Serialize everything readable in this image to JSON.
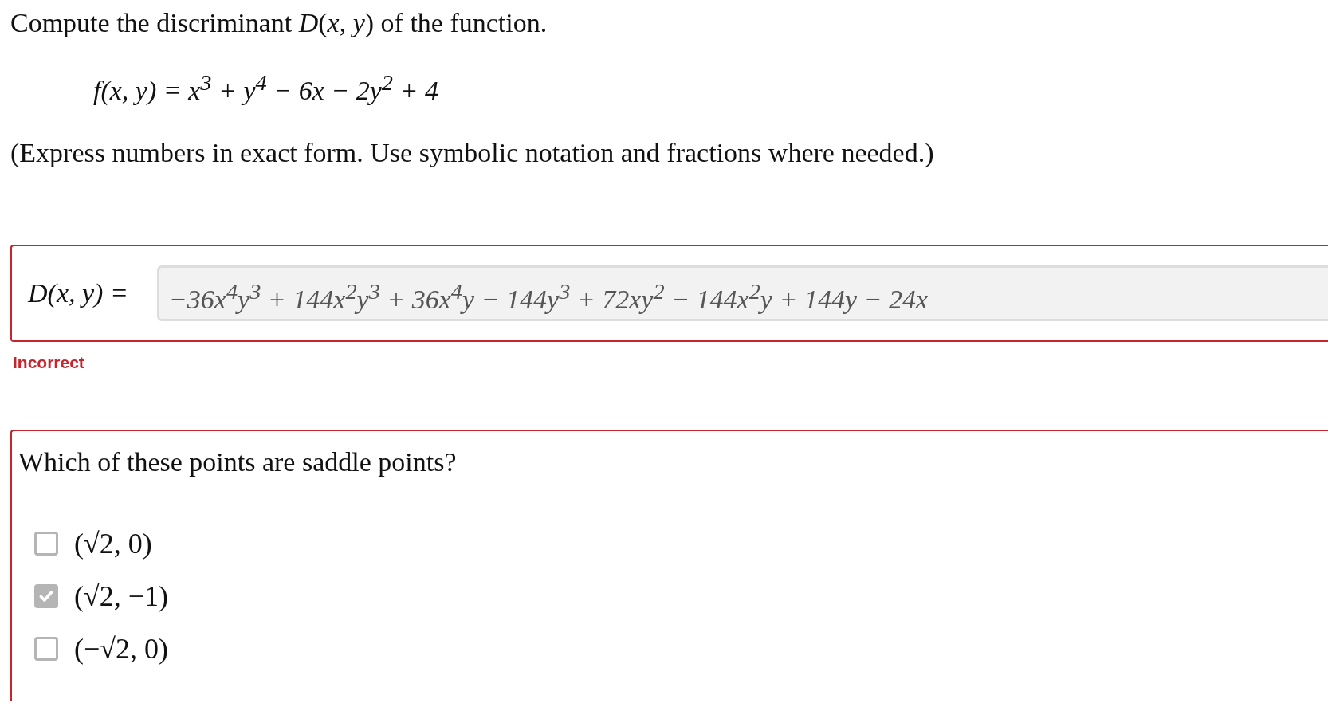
{
  "prompt": "Compute the discriminant *D*(*x*, *y*) of the function.",
  "function": "f(x, y) = x$^{3}$ + y$^{4}$ − 6x − 2y$^{2}$ + 4",
  "instruction": "(Express numbers in exact form. Use symbolic notation and fractions where needed.)",
  "answer": {
    "label": "*D*(*x*, *y*) =",
    "value": "−36x$^{4}$y$^{3}$ + 144x$^{2}$y$^{3}$ + 36x$^{4}$y − 144y$^{3}$ + 72xy$^{2}$ − 144x$^{2}$y + 144y − 24x",
    "status": {
      "kind": "incorrect",
      "text": "Incorrect"
    }
  },
  "question": {
    "text": "Which of these points are saddle points?",
    "options": [
      {
        "label": "(√2, 0)",
        "checked": false
      },
      {
        "label": "(√2, −1)",
        "checked": true
      },
      {
        "label": "(−√2, 0)",
        "checked": false
      }
    ]
  }
}
